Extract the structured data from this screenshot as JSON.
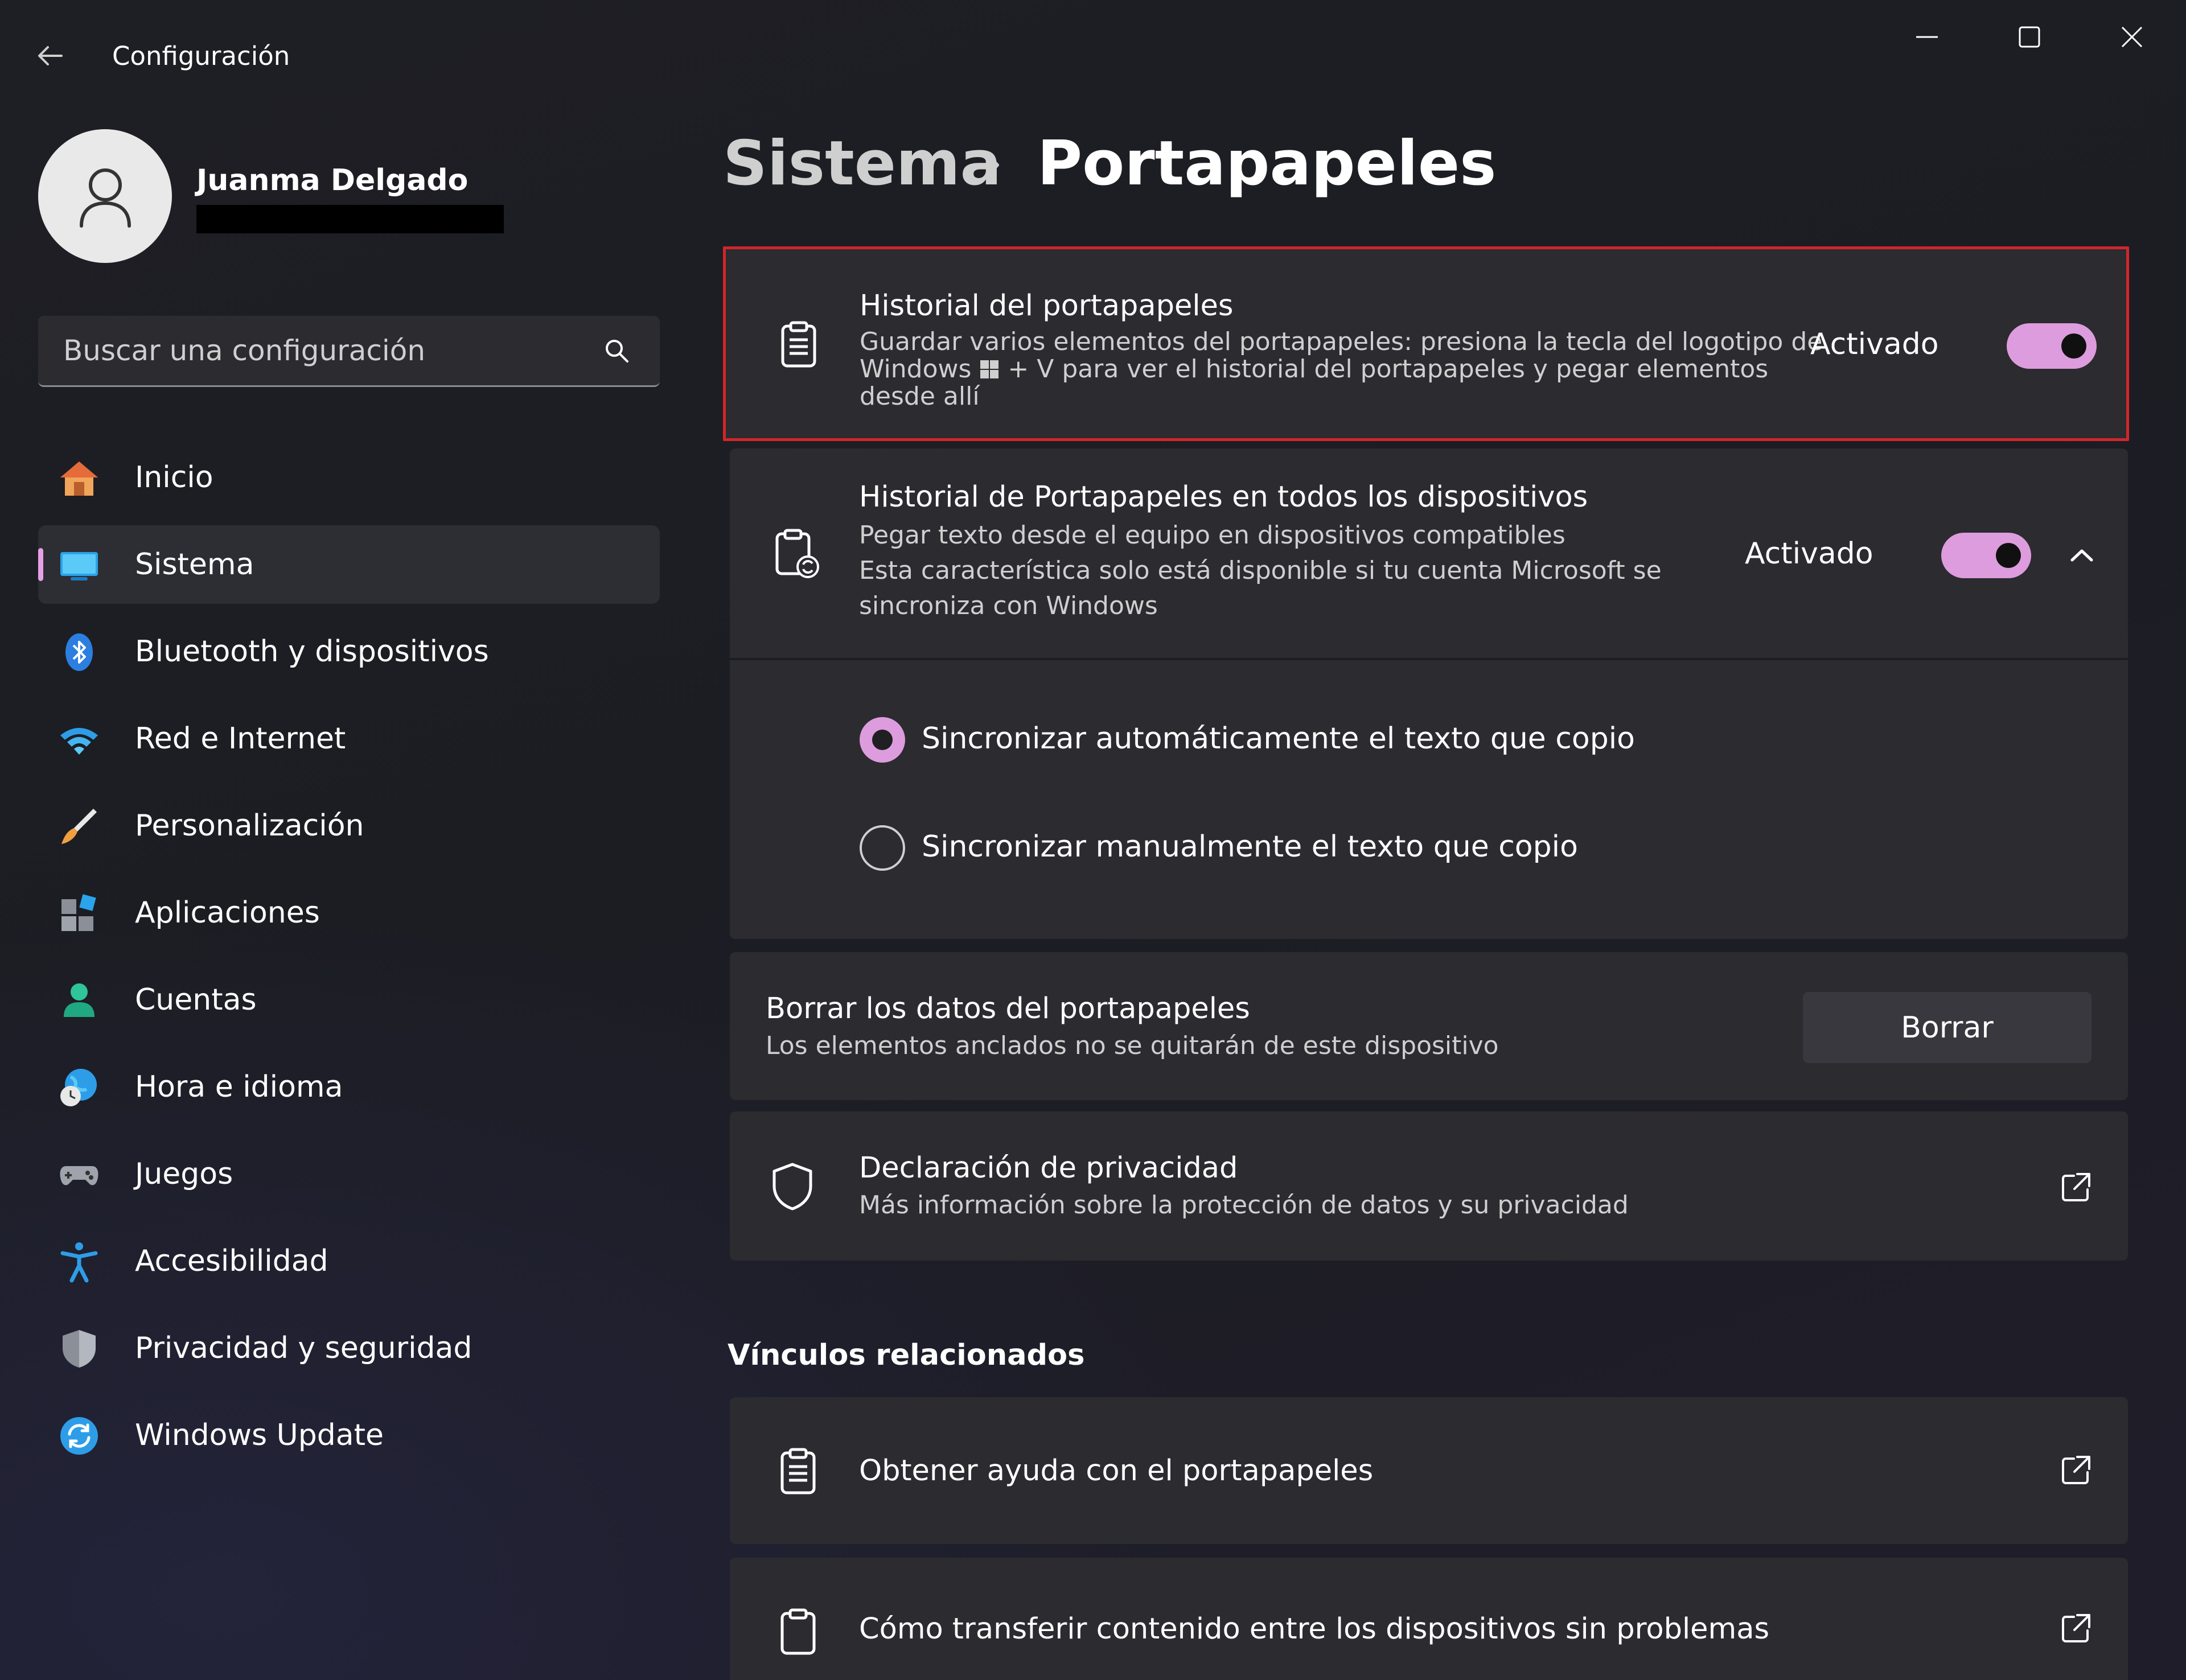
{
  "window": {
    "title": "Configuración",
    "controls": [
      "minimize",
      "maximize",
      "close"
    ]
  },
  "profile": {
    "name": "Juanma Delgado"
  },
  "search": {
    "placeholder": "Buscar una configuración"
  },
  "sidebar": {
    "items": [
      {
        "label": "Inicio",
        "icon": "home-icon"
      },
      {
        "label": "Sistema",
        "icon": "system-monitor-icon",
        "active": true
      },
      {
        "label": "Bluetooth y dispositivos",
        "icon": "bluetooth-icon"
      },
      {
        "label": "Red e Internet",
        "icon": "wifi-icon"
      },
      {
        "label": "Personalización",
        "icon": "paintbrush-icon"
      },
      {
        "label": "Aplicaciones",
        "icon": "apps-icon"
      },
      {
        "label": "Cuentas",
        "icon": "person-icon"
      },
      {
        "label": "Hora e idioma",
        "icon": "globe-clock-icon"
      },
      {
        "label": "Juegos",
        "icon": "gamepad-icon"
      },
      {
        "label": "Accesibilidad",
        "icon": "accessibility-icon"
      },
      {
        "label": "Privacidad y seguridad",
        "icon": "shield-icon"
      },
      {
        "label": "Windows Update",
        "icon": "update-icon"
      }
    ]
  },
  "header": {
    "parent": "Sistema",
    "separator": "›",
    "current": "Portapapeles"
  },
  "clipboard_history": {
    "title": "Historial del portapapeles",
    "desc1": "Guardar varios elementos del portapapeles: presiona la tecla del logotipo de",
    "desc2a": "Windows",
    "desc2b": "+ V para ver el historial del portapapeles y pegar elementos",
    "desc3": "desde allí",
    "state": "Activado",
    "on": true,
    "highlight_color": "#d1262b"
  },
  "sync_devices": {
    "title": "Historial de Portapapeles en todos los dispositivos",
    "desc1": "Pegar texto desde el equipo en dispositivos compatibles",
    "desc2": "Esta característica solo está disponible si tu cuenta Microsoft se",
    "desc3": "sincroniza con Windows",
    "state": "Activado",
    "on": true,
    "expanded": true,
    "options": [
      {
        "label": "Sincronizar automáticamente el texto que copio",
        "selected": true
      },
      {
        "label": "Sincronizar manualmente el texto que copio",
        "selected": false
      }
    ]
  },
  "clear_data": {
    "title": "Borrar los datos del portapapeles",
    "desc": "Los elementos anclados no se quitarán de este dispositivo",
    "button": "Borrar"
  },
  "privacy": {
    "title": "Declaración de privacidad",
    "desc": "Más información sobre la protección de datos y su privacidad"
  },
  "related": {
    "heading": "Vínculos relacionados",
    "links": [
      {
        "label": "Obtener ayuda con el portapapeles",
        "icon": "clipboard-list-icon"
      },
      {
        "label": "Cómo transferir contenido entre los dispositivos sin problemas",
        "icon": "clipboard-icon"
      }
    ]
  },
  "colors": {
    "accent": "#dd9cdd",
    "background": "#1c1c21",
    "card": "#2b2b30"
  }
}
